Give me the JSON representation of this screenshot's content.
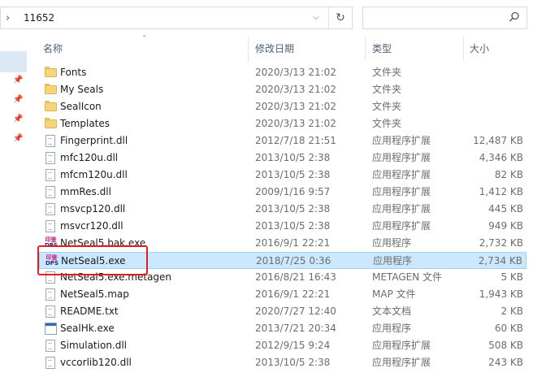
{
  "address": {
    "chevron": "›",
    "path": "11652"
  },
  "columns": {
    "name": "名称",
    "date": "修改日期",
    "type": "类型",
    "size": "大小"
  },
  "files": [
    {
      "name": "Fonts",
      "date": "2020/3/13 21:02",
      "type": "文件夹",
      "size": "",
      "icon": "folder-icon",
      "selected": false
    },
    {
      "name": "My Seals",
      "date": "2020/3/13 21:02",
      "type": "文件夹",
      "size": "",
      "icon": "folder-icon",
      "selected": false
    },
    {
      "name": "SealIcon",
      "date": "2020/3/13 21:02",
      "type": "文件夹",
      "size": "",
      "icon": "folder-icon",
      "selected": false
    },
    {
      "name": "Templates",
      "date": "2020/3/13 21:02",
      "type": "文件夹",
      "size": "",
      "icon": "folder-icon",
      "selected": false
    },
    {
      "name": "Fingerprint.dll",
      "date": "2012/7/18 21:51",
      "type": "应用程序扩展",
      "size": "12,487 KB",
      "icon": "dll-icon",
      "selected": false
    },
    {
      "name": "mfc120u.dll",
      "date": "2013/10/5 2:38",
      "type": "应用程序扩展",
      "size": "4,346 KB",
      "icon": "dll-icon",
      "selected": false
    },
    {
      "name": "mfcm120u.dll",
      "date": "2013/10/5 2:38",
      "type": "应用程序扩展",
      "size": "82 KB",
      "icon": "dll-icon",
      "selected": false
    },
    {
      "name": "mmRes.dll",
      "date": "2009/1/16 9:57",
      "type": "应用程序扩展",
      "size": "1,412 KB",
      "icon": "dll-icon",
      "selected": false
    },
    {
      "name": "msvcp120.dll",
      "date": "2013/10/5 2:38",
      "type": "应用程序扩展",
      "size": "445 KB",
      "icon": "dll-icon",
      "selected": false
    },
    {
      "name": "msvcr120.dll",
      "date": "2013/10/5 2:38",
      "type": "应用程序扩展",
      "size": "949 KB",
      "icon": "dll-icon",
      "selected": false
    },
    {
      "name": "NetSeal5.bak.exe",
      "date": "2016/9/1 22:21",
      "type": "应用程序",
      "size": "2,732 KB",
      "icon": "seal-app-icon",
      "selected": false
    },
    {
      "name": "NetSeal5.exe",
      "date": "2018/7/25 0:36",
      "type": "应用程序",
      "size": "2,734 KB",
      "icon": "seal-app-icon",
      "selected": true
    },
    {
      "name": "NetSeal5.exe.metagen",
      "date": "2016/8/21 16:43",
      "type": "METAGEN 文件",
      "size": "5 KB",
      "icon": "file-icon",
      "selected": false
    },
    {
      "name": "NetSeal5.map",
      "date": "2016/9/1 22:21",
      "type": "MAP 文件",
      "size": "1,943 KB",
      "icon": "file-icon",
      "selected": false
    },
    {
      "name": "README.txt",
      "date": "2020/7/27 12:40",
      "type": "文本文档",
      "size": "2 KB",
      "icon": "text-file-icon",
      "selected": false
    },
    {
      "name": "SealHk.exe",
      "date": "2013/7/21 20:34",
      "type": "应用程序",
      "size": "60 KB",
      "icon": "exe-icon",
      "selected": false
    },
    {
      "name": "Simulation.dll",
      "date": "2012/9/15 9:24",
      "type": "应用程序扩展",
      "size": "508 KB",
      "icon": "dll-icon",
      "selected": false
    },
    {
      "name": "vccorlib120.dll",
      "date": "2013/10/5 2:38",
      "type": "应用程序扩展",
      "size": "243 KB",
      "icon": "dll-icon",
      "selected": false
    }
  ],
  "seal_icon_glyphs": {
    "top": "印鉴",
    "bottom": "DPS"
  },
  "colors": {
    "selection": "#cce8ff",
    "highlight_box": "#e02020",
    "folder": "#f7d37a"
  }
}
